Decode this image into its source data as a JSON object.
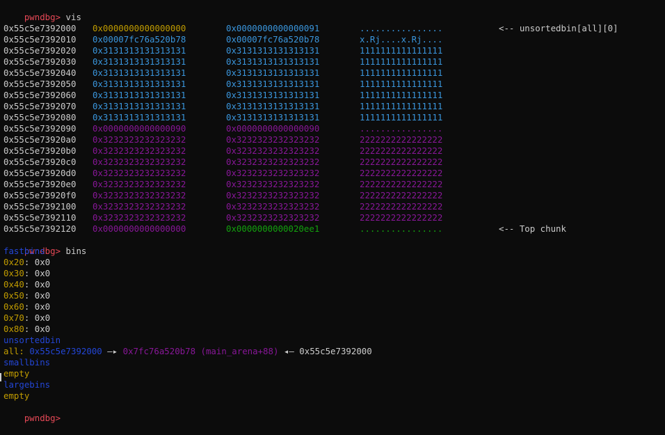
{
  "prompt": "pwndbg>",
  "command_vis": "vis",
  "command_bins": "bins",
  "colors": {
    "background": "#0c0c0c",
    "prompt": "#e74856",
    "yellow": "#c19c00",
    "cyan": "#3a96dd",
    "magenta": "#881798",
    "green": "#13a10e",
    "blue": "#2346d6",
    "white": "#cccccc"
  },
  "vis_rows": [
    {
      "addr": "0x55c5e7392000",
      "q1": "0x0000000000000000",
      "q2": "0x0000000000000091",
      "ascii": "................",
      "note": "<-- unsortedbin[all][0]",
      "color": "cyan",
      "q1color": "yellow"
    },
    {
      "addr": "0x55c5e7392010",
      "q1": "0x00007fc76a520b78",
      "q2": "0x00007fc76a520b78",
      "ascii": "x.Rj....x.Rj....",
      "note": "",
      "color": "cyan",
      "q1color": "cyan"
    },
    {
      "addr": "0x55c5e7392020",
      "q1": "0x3131313131313131",
      "q2": "0x3131313131313131",
      "ascii": "1111111111111111",
      "note": "",
      "color": "cyan",
      "q1color": "cyan"
    },
    {
      "addr": "0x55c5e7392030",
      "q1": "0x3131313131313131",
      "q2": "0x3131313131313131",
      "ascii": "1111111111111111",
      "note": "",
      "color": "cyan",
      "q1color": "cyan"
    },
    {
      "addr": "0x55c5e7392040",
      "q1": "0x3131313131313131",
      "q2": "0x3131313131313131",
      "ascii": "1111111111111111",
      "note": "",
      "color": "cyan",
      "q1color": "cyan"
    },
    {
      "addr": "0x55c5e7392050",
      "q1": "0x3131313131313131",
      "q2": "0x3131313131313131",
      "ascii": "1111111111111111",
      "note": "",
      "color": "cyan",
      "q1color": "cyan"
    },
    {
      "addr": "0x55c5e7392060",
      "q1": "0x3131313131313131",
      "q2": "0x3131313131313131",
      "ascii": "1111111111111111",
      "note": "",
      "color": "cyan",
      "q1color": "cyan"
    },
    {
      "addr": "0x55c5e7392070",
      "q1": "0x3131313131313131",
      "q2": "0x3131313131313131",
      "ascii": "1111111111111111",
      "note": "",
      "color": "cyan",
      "q1color": "cyan"
    },
    {
      "addr": "0x55c5e7392080",
      "q1": "0x3131313131313131",
      "q2": "0x3131313131313131",
      "ascii": "1111111111111111",
      "note": "",
      "color": "cyan",
      "q1color": "cyan"
    },
    {
      "addr": "0x55c5e7392090",
      "q1": "0x0000000000000090",
      "q2": "0x0000000000000090",
      "ascii": "................",
      "note": "",
      "color": "magenta",
      "q1color": "magenta"
    },
    {
      "addr": "0x55c5e73920a0",
      "q1": "0x3232323232323232",
      "q2": "0x3232323232323232",
      "ascii": "2222222222222222",
      "note": "",
      "color": "magenta",
      "q1color": "magenta"
    },
    {
      "addr": "0x55c5e73920b0",
      "q1": "0x3232323232323232",
      "q2": "0x3232323232323232",
      "ascii": "2222222222222222",
      "note": "",
      "color": "magenta",
      "q1color": "magenta"
    },
    {
      "addr": "0x55c5e73920c0",
      "q1": "0x3232323232323232",
      "q2": "0x3232323232323232",
      "ascii": "2222222222222222",
      "note": "",
      "color": "magenta",
      "q1color": "magenta"
    },
    {
      "addr": "0x55c5e73920d0",
      "q1": "0x3232323232323232",
      "q2": "0x3232323232323232",
      "ascii": "2222222222222222",
      "note": "",
      "color": "magenta",
      "q1color": "magenta"
    },
    {
      "addr": "0x55c5e73920e0",
      "q1": "0x3232323232323232",
      "q2": "0x3232323232323232",
      "ascii": "2222222222222222",
      "note": "",
      "color": "magenta",
      "q1color": "magenta"
    },
    {
      "addr": "0x55c5e73920f0",
      "q1": "0x3232323232323232",
      "q2": "0x3232323232323232",
      "ascii": "2222222222222222",
      "note": "",
      "color": "magenta",
      "q1color": "magenta"
    },
    {
      "addr": "0x55c5e7392100",
      "q1": "0x3232323232323232",
      "q2": "0x3232323232323232",
      "ascii": "2222222222222222",
      "note": "",
      "color": "magenta",
      "q1color": "magenta"
    },
    {
      "addr": "0x55c5e7392110",
      "q1": "0x3232323232323232",
      "q2": "0x3232323232323232",
      "ascii": "2222222222222222",
      "note": "",
      "color": "magenta",
      "q1color": "magenta"
    },
    {
      "addr": "0x55c5e7392120",
      "q1": "0x0000000000000000",
      "q2": "0x0000000000020ee1",
      "ascii": "................",
      "note": "<-- Top chunk",
      "color": "green",
      "q1color": "magenta"
    }
  ],
  "bins": {
    "fastbins_label": "fastbins",
    "fastbins": [
      {
        "size": "0x20",
        "value": "0x0"
      },
      {
        "size": "0x30",
        "value": "0x0"
      },
      {
        "size": "0x40",
        "value": "0x0"
      },
      {
        "size": "0x50",
        "value": "0x0"
      },
      {
        "size": "0x60",
        "value": "0x0"
      },
      {
        "size": "0x70",
        "value": "0x0"
      },
      {
        "size": "0x80",
        "value": "0x0"
      }
    ],
    "unsortedbin_label": "unsortedbin",
    "unsorted_all": {
      "key": "all:",
      "addr": "0x55c5e7392000",
      "arrow1": "—▸",
      "fd": "0x7fc76a520b78",
      "fd_sym": "(main_arena+88)",
      "arrow2": "◂—",
      "bk": "0x55c5e7392000"
    },
    "smallbins_label": "smallbins",
    "smallbins_value": "empty",
    "largebins_label": "largebins",
    "largebins_value": "empty"
  }
}
